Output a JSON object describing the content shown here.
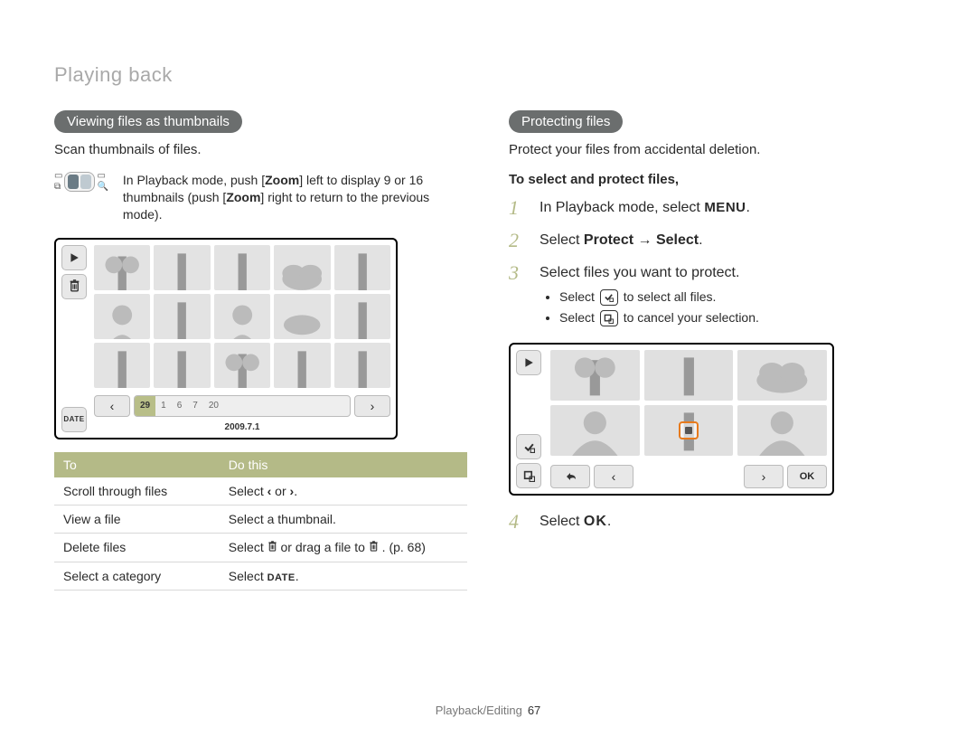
{
  "section_title": "Playing back",
  "left": {
    "pill": "Viewing files as thumbnails",
    "lead": "Scan thumbnails of files.",
    "tip_pre": "In Playback mode, push [",
    "tip_zoom": "Zoom",
    "tip_mid1": "] left to display 9 or 16 thumbnails (push [",
    "tip_mid2": "] right to return to the previous mode).",
    "date_strip": {
      "sel": "29",
      "nums": [
        "1",
        "6",
        "7",
        "20"
      ]
    },
    "date_caption": "2009.7.1",
    "table": {
      "head_to": "To",
      "head_do": "Do this",
      "rows": [
        {
          "to": "Scroll through files",
          "do_pre": "Select ",
          "do_icons": [
            "‹",
            "›"
          ],
          "do_join": " or ",
          "do_post": "."
        },
        {
          "to": "View a file",
          "do_pre": "Select a thumbnail.",
          "do_icons": [],
          "do_join": "",
          "do_post": ""
        },
        {
          "to": "Delete files",
          "do_pre": "Select ",
          "do_icons": [
            "trash",
            "trash"
          ],
          "do_join": " or drag a file to ",
          "do_post": ". (p. 68)"
        },
        {
          "to": "Select a category",
          "do_pre": "Select ",
          "do_icons": [
            "DATE"
          ],
          "do_join": "",
          "do_post": "."
        }
      ]
    }
  },
  "right": {
    "pill": "Protecting files",
    "lead": "Protect your files from accidental deletion.",
    "sub_head": "To select and protect files,",
    "steps": {
      "s1_pre": "In Playback mode, select ",
      "s1_menu": "MENU",
      "s1_post": ".",
      "s2_pre": "Select ",
      "s2_b1": "Protect",
      "s2_arrow": " → ",
      "s2_b2": "Select",
      "s2_post": ".",
      "s3": "Select files you want to protect.",
      "s3_b1_pre": "Select ",
      "s3_b1_post": " to select all files.",
      "s3_b2_pre": "Select ",
      "s3_b2_post": " to cancel your selection.",
      "s4_pre": "Select ",
      "s4_ok": "OK",
      "s4_post": "."
    },
    "nums": {
      "n1": "1",
      "n2": "2",
      "n3": "3",
      "n4": "4"
    }
  },
  "footer": {
    "label": "Playback/Editing",
    "page": "67"
  },
  "icons": {
    "play": "▶",
    "trash_svg": "trash",
    "date_label": "DATE",
    "check_all": "✔",
    "cancel_sel": "▢",
    "back": "↶",
    "left": "‹",
    "right": "›",
    "ok_btn": "OK"
  }
}
